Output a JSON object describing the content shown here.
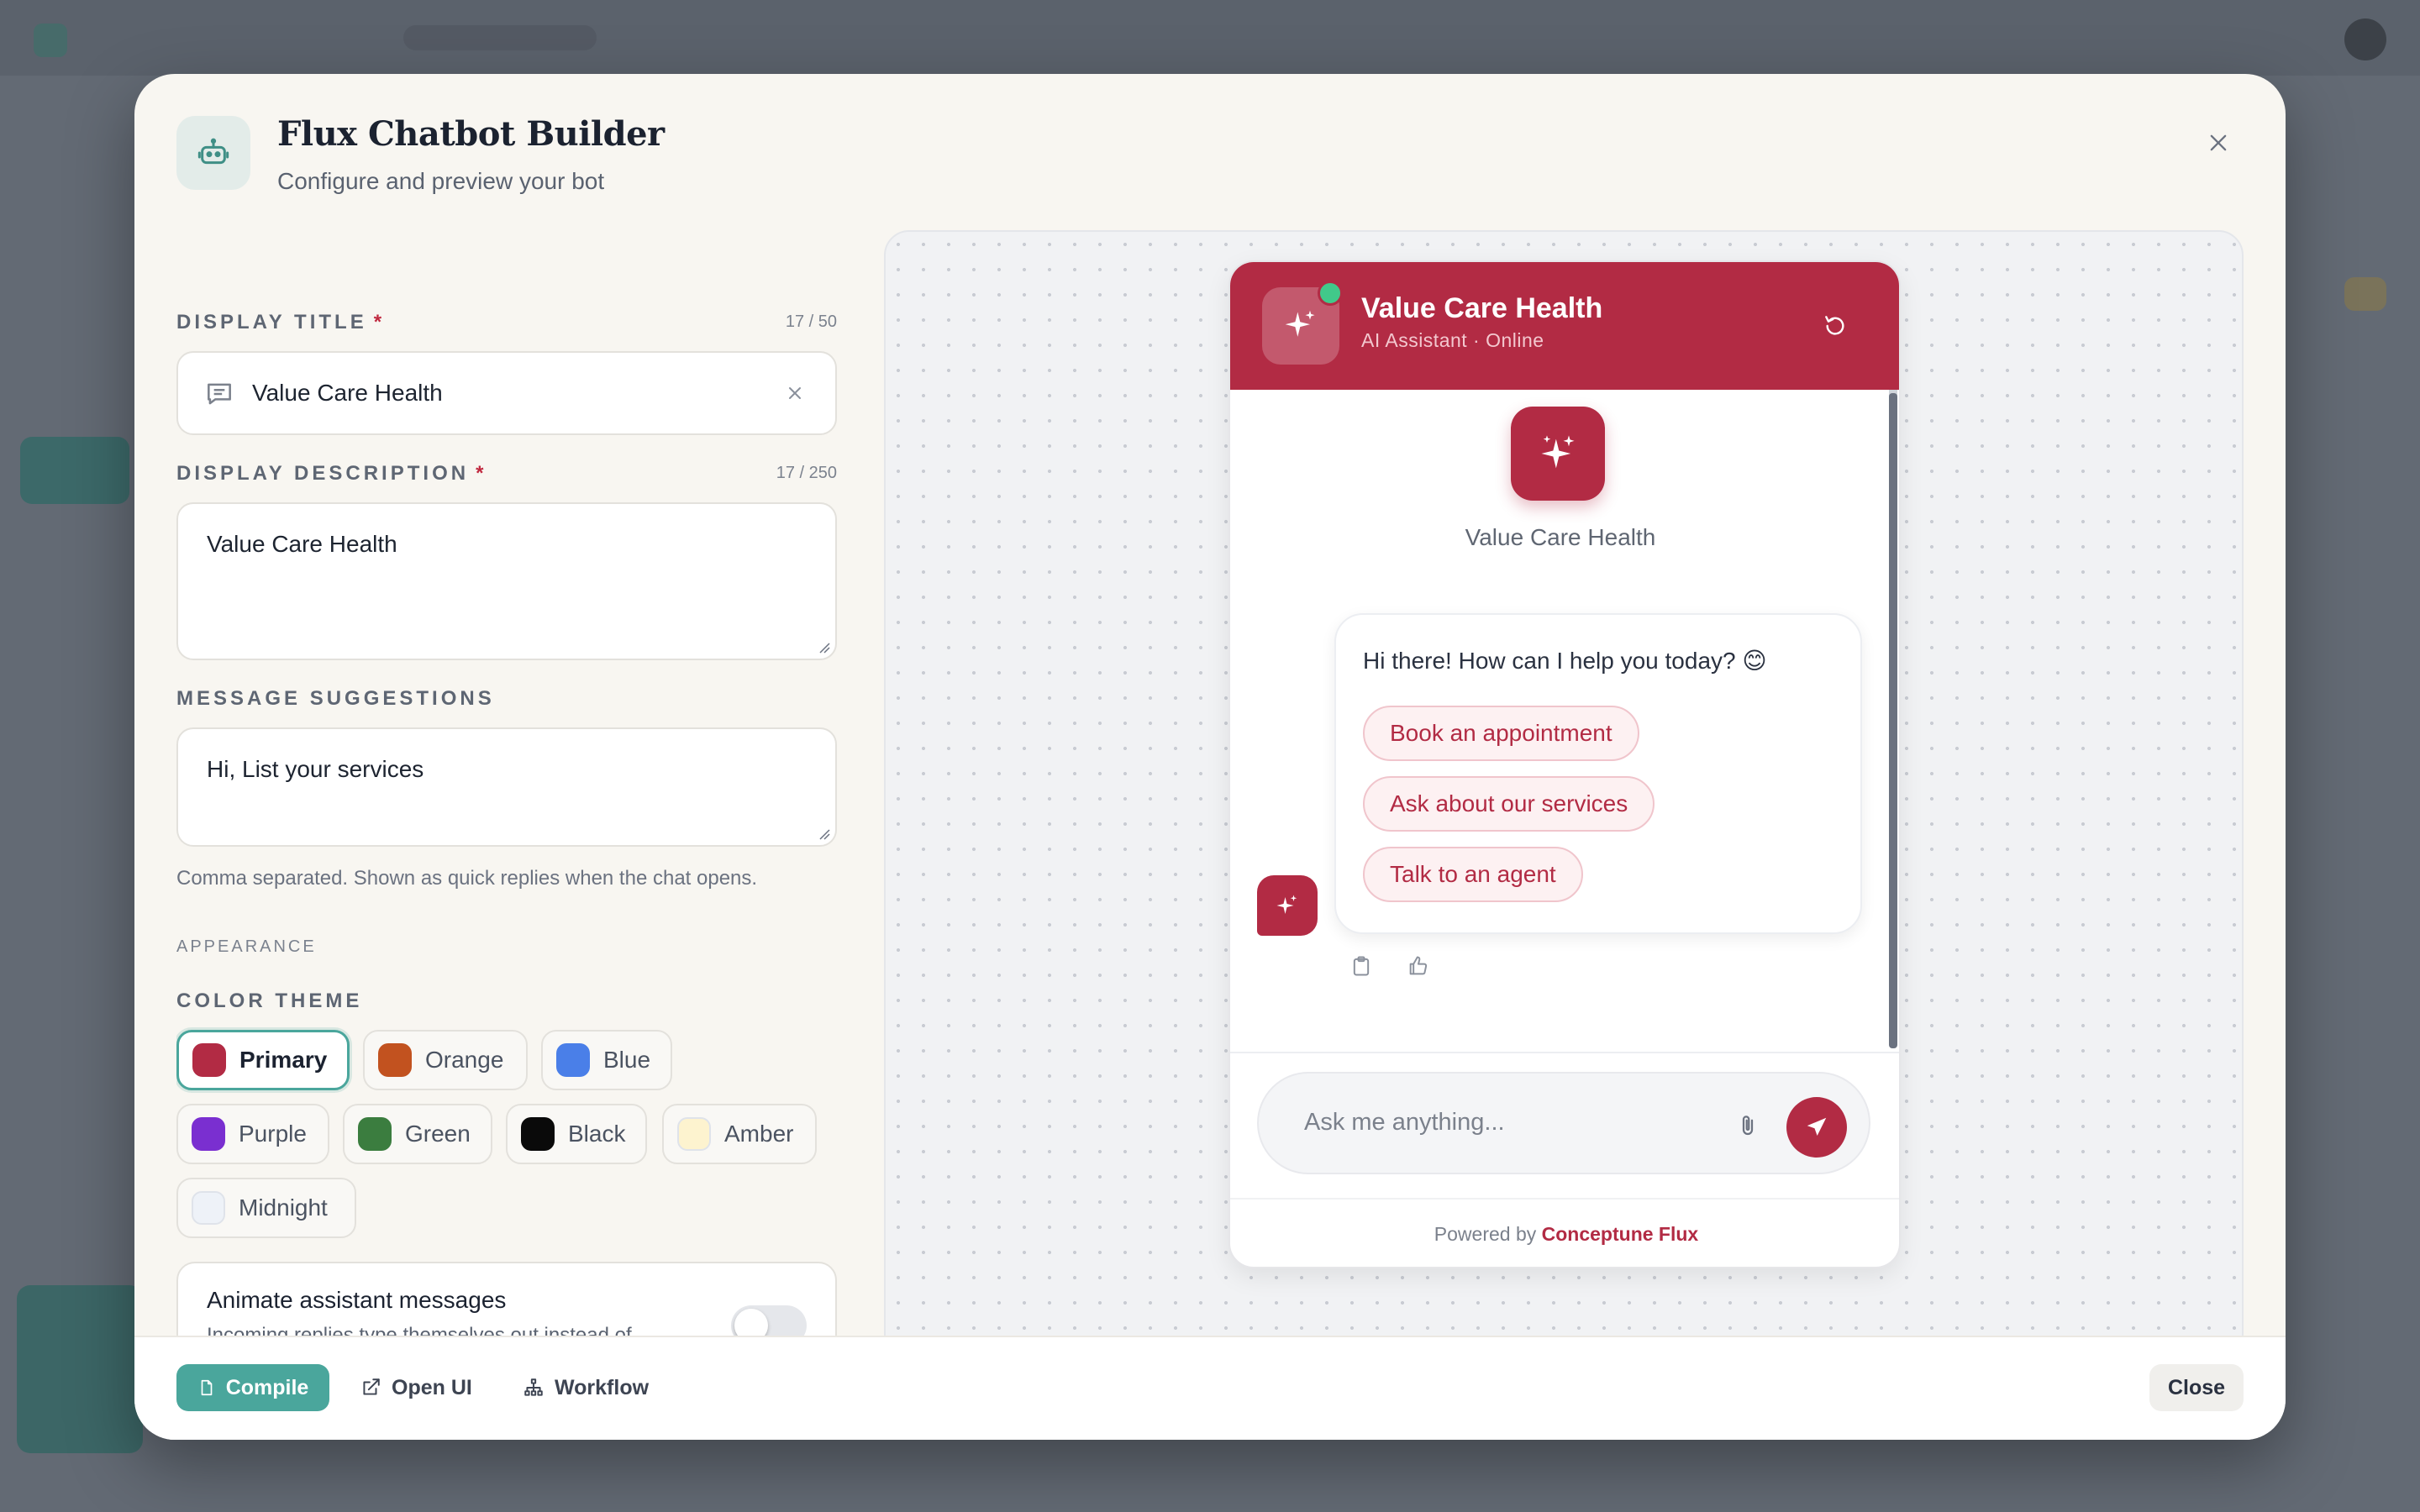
{
  "modal": {
    "title": "Flux Chatbot Builder",
    "subtitle": "Configure and preview your bot"
  },
  "form": {
    "display_title": {
      "label": "DISPLAY TITLE",
      "required_mark": "*",
      "counter": "17 / 50",
      "value": "Value Care Health"
    },
    "display_description": {
      "label": "DISPLAY DESCRIPTION",
      "required_mark": "*",
      "counter": "17 / 250",
      "value": "Value Care Health"
    },
    "message_suggestions": {
      "label": "MESSAGE SUGGESTIONS",
      "value": "Hi, List your services",
      "hint": "Comma separated. Shown as quick replies when the chat opens."
    },
    "appearance_label": "APPEARANCE",
    "color_theme": {
      "label": "COLOR THEME",
      "selected": "Primary",
      "options": [
        {
          "name": "Primary",
          "color": "#b22b44"
        },
        {
          "name": "Orange",
          "color": "#c2521f"
        },
        {
          "name": "Blue",
          "color": "#4a7fe8"
        },
        {
          "name": "Purple",
          "color": "#7a2fd0"
        },
        {
          "name": "Green",
          "color": "#3b7d3f"
        },
        {
          "name": "Black",
          "color": "#0a0a0a"
        },
        {
          "name": "Amber",
          "color": "#fdf3cf"
        },
        {
          "name": "Midnight",
          "color": "#eef2f8"
        }
      ]
    },
    "animate": {
      "title": "Animate assistant messages",
      "description": "Incoming replies type themselves out instead of appearing at once.",
      "enabled": false
    }
  },
  "preview": {
    "header_title": "Value Care Health",
    "header_subtitle": "AI Assistant · Online",
    "bot_name": "Value Care Health",
    "greeting": "Hi there! How can I help you today? 😊",
    "quick_replies": [
      "Book an appointment",
      "Ask about our services",
      "Talk to an agent"
    ],
    "input_placeholder": "Ask me anything...",
    "powered_prefix": "Powered by",
    "powered_brand": "Conceptune Flux",
    "accent_color": "#b22b44"
  },
  "footer": {
    "compile": "Compile",
    "open_ui": "Open UI",
    "workflow": "Workflow",
    "close": "Close"
  }
}
